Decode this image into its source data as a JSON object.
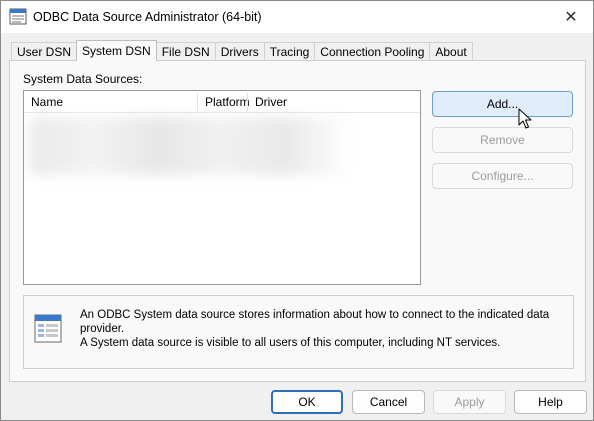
{
  "window": {
    "title": "ODBC Data Source Administrator (64-bit)",
    "close_glyph": "✕"
  },
  "tabs": [
    {
      "label": "User DSN",
      "active": false
    },
    {
      "label": "System DSN",
      "active": true
    },
    {
      "label": "File DSN",
      "active": false
    },
    {
      "label": "Drivers",
      "active": false
    },
    {
      "label": "Tracing",
      "active": false
    },
    {
      "label": "Connection Pooling",
      "active": false
    },
    {
      "label": "About",
      "active": false
    }
  ],
  "panel": {
    "list_label": "System Data Sources:",
    "columns": [
      "Name",
      "Platform",
      "Driver"
    ],
    "buttons": {
      "add": "Add...",
      "remove": "Remove",
      "configure": "Configure..."
    },
    "info_text_1": "An ODBC System data source stores information about how to connect to the indicated data provider.",
    "info_text_2": "A System data source is visible to all users of this computer, including NT services."
  },
  "footer": {
    "ok": "OK",
    "cancel": "Cancel",
    "apply": "Apply",
    "help": "Help"
  },
  "colors": {
    "accent": "#2f6fb8",
    "hover_fill": "#e0ecf9",
    "disabled_text": "#9c9c9c"
  },
  "icons": [
    "odbc-app-icon",
    "close-icon",
    "data-source-info-icon",
    "mouse-cursor-icon"
  ]
}
